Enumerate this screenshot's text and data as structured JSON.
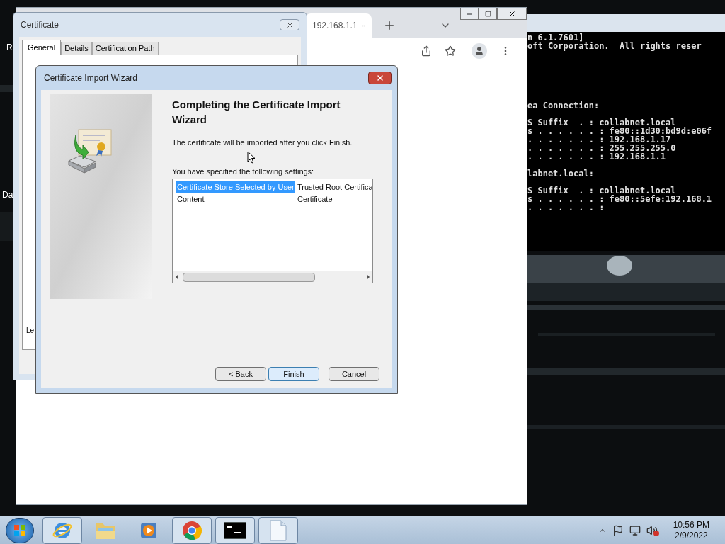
{
  "desktop": {
    "icon_labels": [
      {
        "text": "R"
      },
      {
        "text": "Da"
      }
    ]
  },
  "console": {
    "line_groups": [
      [
        "n 6.1.7601]",
        "oft Corporation.  All rights reser"
      ],
      [
        "ea Connection:"
      ],
      [
        "S Suffix  . : collabnet.local",
        "s . . . . . . : fe80::1d30:bd9d:e06f",
        ". . . . . . . : 192.168.1.17",
        ". . . . . . . : 255.255.255.0",
        ". . . . . . . : 192.168.1.1"
      ],
      [
        "labnet.local:"
      ],
      [
        "S Suffix  . : collabnet.local",
        "s . . . . . . : fe80::5efe:192.168.1",
        ". . . . . . . :"
      ]
    ]
  },
  "browser": {
    "tab": {
      "title": "192.168.1.1"
    }
  },
  "certificate_dialog": {
    "title": "Certificate",
    "tabs": [
      {
        "label": "General",
        "selected": true
      },
      {
        "label": "Details",
        "selected": false
      },
      {
        "label": "Certification Path",
        "selected": false
      }
    ],
    "partial_label": "Le"
  },
  "import_wizard": {
    "title": "Certificate Import Wizard",
    "heading": "Completing the Certificate Import Wizard",
    "message": "The certificate will be imported after you click Finish.",
    "settings_label": "You have specified the following settings:",
    "settings": [
      {
        "field": "Certificate Store Selected by User",
        "value": "Trusted Root Certifica",
        "selected": true
      },
      {
        "field": "Content",
        "value": "Certificate",
        "selected": false
      }
    ],
    "buttons": [
      {
        "label": "< Back",
        "kind": "normal"
      },
      {
        "label": "Finish",
        "kind": "default"
      },
      {
        "label": "Cancel",
        "kind": "normal"
      }
    ]
  },
  "taskbar": {
    "apps": [
      {
        "kind": "ie",
        "running": true
      },
      {
        "kind": "folder",
        "running": false
      },
      {
        "kind": "media",
        "running": false
      },
      {
        "kind": "chrome",
        "running": true
      },
      {
        "kind": "console",
        "running": true
      },
      {
        "kind": "document",
        "running": true
      }
    ],
    "clock": {
      "time": "10:56 PM",
      "date": "2/9/2022"
    }
  }
}
